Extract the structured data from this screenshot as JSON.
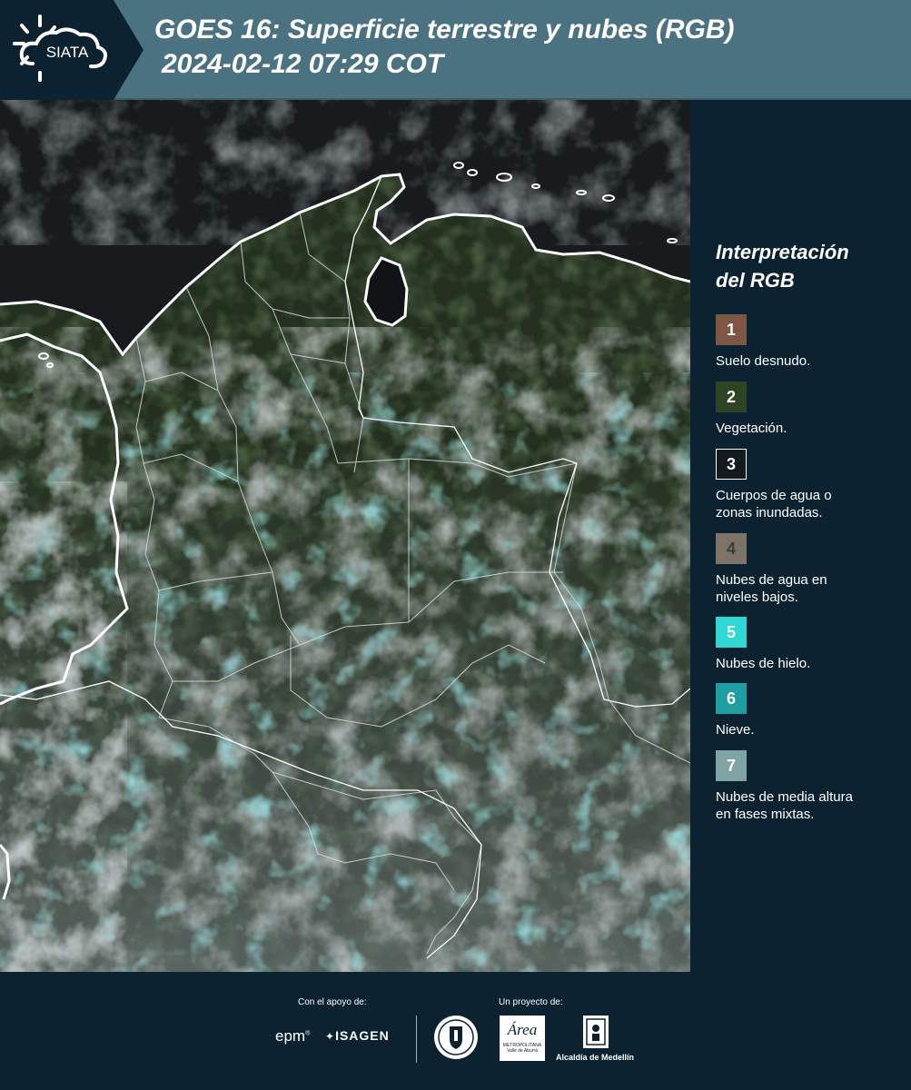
{
  "header": {
    "brand": "SIATA",
    "title_line1": "GOES 16: Superficie terrestre y nubes (RGB)",
    "title_line2": "2024-02-12 07:29 COT"
  },
  "legend": {
    "title_line1": "Interpretación",
    "title_line2": "del RGB",
    "items": [
      {
        "number": "1",
        "color": "#7d5646",
        "label_lines": [
          "Suelo desnudo."
        ]
      },
      {
        "number": "2",
        "color": "#2e4424",
        "label_lines": [
          "Vegetación."
        ]
      },
      {
        "number": "3",
        "color": "#141a1e",
        "label_lines": [
          "Cuerpos de agua o",
          "zonas inundadas."
        ]
      },
      {
        "number": "4",
        "color": "#7c7468",
        "label_lines": [
          "Nubes de agua en",
          "niveles bajos."
        ]
      },
      {
        "number": "5",
        "color": "#2fd8d4",
        "label_lines": [
          "Nubes de hielo."
        ]
      },
      {
        "number": "6",
        "color": "#1e9ea2",
        "label_lines": [
          "Nieve."
        ]
      },
      {
        "number": "7",
        "color": "#7fa4a6",
        "label_lines": [
          "Nubes de media altura",
          "en fases mixtas."
        ]
      }
    ]
  },
  "footer": {
    "support_label": "Con el apoyo de:",
    "project_label": "Un proyecto de:",
    "logo_epm": "epm",
    "logo_isagen": "ISAGEN",
    "logo_area_line1": "Área",
    "logo_area_line2": "METROPOLITANA",
    "logo_area_line3": "Valle de Aburrá",
    "logo_alcaldia": "Alcaldía de Medellín"
  },
  "colors": {
    "header_bg": "#4b7280",
    "panel_bg": "#0d2230",
    "vegetation": "#2e4424",
    "cloud": "#8c9699",
    "ice_cloud": "#4fb7bb",
    "coastline": "#ffffff"
  }
}
